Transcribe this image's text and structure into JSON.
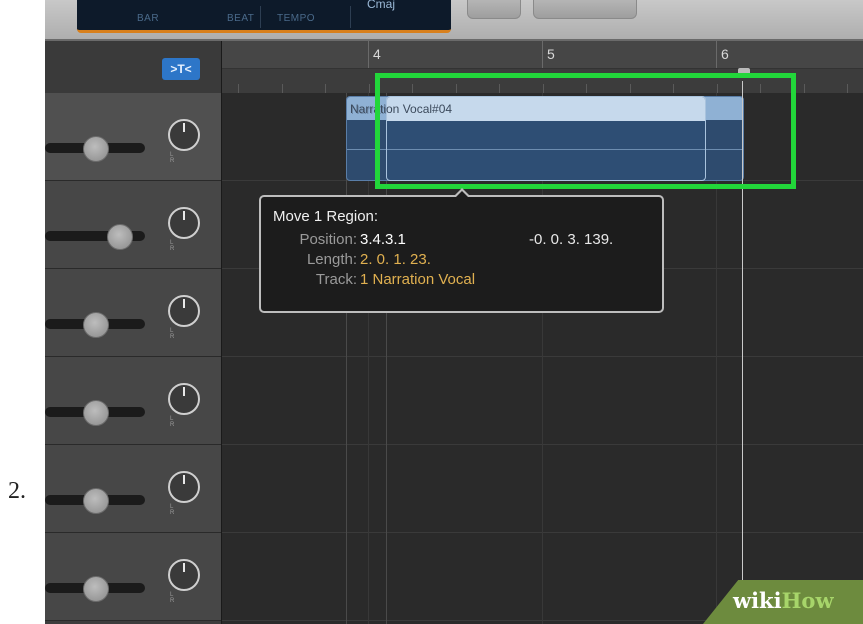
{
  "step_number": "2.",
  "lcd": {
    "labels": [
      "BAR",
      "BEAT",
      "TEMPO"
    ],
    "key": "Cmaj"
  },
  "filter_button": ">T<",
  "ruler": {
    "bars": [
      "4",
      "5",
      "6"
    ]
  },
  "tracks": [
    {
      "volume": 0.5,
      "pan_label": "L R"
    },
    {
      "volume": 0.74,
      "pan_label": "L R"
    },
    {
      "volume": 0.5,
      "pan_label": "L R"
    },
    {
      "volume": 0.5,
      "pan_label": "L R"
    },
    {
      "volume": 0.5,
      "pan_label": "L R"
    },
    {
      "volume": 0.5,
      "pan_label": "L R"
    }
  ],
  "region": {
    "name": "Narration Vocal#04",
    "ghost_name": "Narration Vocal#04"
  },
  "tooltip": {
    "title": "Move 1 Region:",
    "rows": [
      {
        "key": "Position:",
        "value": "3.4.3.1",
        "color": "#ffffff"
      },
      {
        "key": "Length:",
        "value": "2. 0. 1. 23.",
        "color": "#e0b050"
      },
      {
        "key": "Track:",
        "value": "1  Narration Vocal",
        "color": "#e0b050"
      }
    ],
    "delta": "-0. 0. 3. 139."
  },
  "watermark": {
    "part1": "wiki",
    "part2": "How"
  },
  "colors": {
    "highlight": "#22d63a",
    "filter_button": "#2d76c8",
    "region": "#2e4e74"
  }
}
